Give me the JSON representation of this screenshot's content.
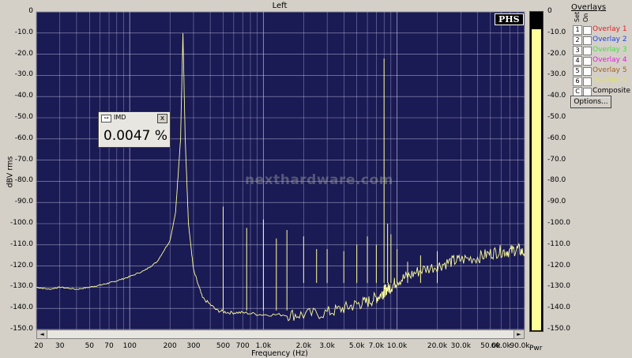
{
  "window": {
    "title": "Left"
  },
  "plot_bg": "#1a1a55",
  "trace_color": "#ffff99",
  "chart_data": {
    "type": "line",
    "xlabel": "Frequency (Hz)",
    "ylabel": "dBV rms",
    "xscale": "log",
    "xlim": [
      20,
      90000
    ],
    "ylim": [
      -150,
      0
    ],
    "y_ticks": [
      "0",
      "-10.0",
      "-20.0",
      "-30.0",
      "-40.0",
      "-50.0",
      "-60.0",
      "-70.0",
      "-80.0",
      "-90.0",
      "-100.0",
      "-110.0",
      "-120.0",
      "-130.0",
      "-140.0",
      "-150.0"
    ],
    "x_ticks": [
      {
        "v": 20,
        "label": "20"
      },
      {
        "v": 30,
        "label": "30"
      },
      {
        "v": 50,
        "label": "50"
      },
      {
        "v": 70,
        "label": "70"
      },
      {
        "v": 100,
        "label": "100"
      },
      {
        "v": 200,
        "label": "200"
      },
      {
        "v": 300,
        "label": "300"
      },
      {
        "v": 500,
        "label": "500"
      },
      {
        "v": 700,
        "label": "700"
      },
      {
        "v": 1000,
        "label": "1.0k"
      },
      {
        "v": 2000,
        "label": "2.0k"
      },
      {
        "v": 3000,
        "label": "3.0k"
      },
      {
        "v": 5000,
        "label": "5.0k"
      },
      {
        "v": 7000,
        "label": "7.0k"
      },
      {
        "v": 10000,
        "label": "10.0k"
      },
      {
        "v": 20000,
        "label": "20.0k"
      },
      {
        "v": 30000,
        "label": "30.0k"
      },
      {
        "v": 50000,
        "label": "50.0k"
      },
      {
        "v": 60000,
        "label": "60.0k"
      },
      {
        "v": 90000,
        "label": "90.0k"
      }
    ],
    "series": [
      {
        "x": [
          20,
          25,
          30,
          40,
          50,
          60,
          70,
          80,
          100,
          130,
          160,
          200,
          220,
          240,
          250,
          260,
          275,
          300,
          350,
          450,
          550,
          700,
          1000,
          1500,
          2000,
          3000,
          4000,
          5000,
          6000,
          7000,
          7800,
          8000,
          8300,
          9000,
          10000,
          12000,
          15000,
          20000,
          25000,
          30000,
          40000,
          50000,
          60000,
          70000,
          80000,
          90000
        ],
        "y": [
          -130,
          -131,
          -130,
          -131,
          -130,
          -129,
          -128,
          -127,
          -125,
          -122,
          -118,
          -108,
          -95,
          -60,
          -10,
          -60,
          -100,
          -122,
          -135,
          -141,
          -142,
          -142,
          -143,
          -143,
          -143,
          -142,
          -140,
          -138,
          -137,
          -135,
          -133,
          -132,
          -131,
          -130,
          -127,
          -125,
          -122,
          -120,
          -118,
          -117,
          -116,
          -114,
          -113,
          -113,
          -112,
          -114
        ]
      }
    ],
    "spikes": [
      {
        "x": 500,
        "y": -92
      },
      {
        "x": 750,
        "y": -102
      },
      {
        "x": 1000,
        "y": -98
      },
      {
        "x": 1250,
        "y": -107
      },
      {
        "x": 1500,
        "y": -103
      },
      {
        "x": 2000,
        "y": -106
      },
      {
        "x": 2500,
        "y": -112
      },
      {
        "x": 3000,
        "y": -112
      },
      {
        "x": 4000,
        "y": -113
      },
      {
        "x": 5000,
        "y": -110
      },
      {
        "x": 6000,
        "y": -106
      },
      {
        "x": 7000,
        "y": -110
      },
      {
        "x": 8000,
        "y": -22
      },
      {
        "x": 8500,
        "y": -100
      },
      {
        "x": 9000,
        "y": -105
      },
      {
        "x": 10000,
        "y": -112
      },
      {
        "x": 12000,
        "y": -118
      },
      {
        "x": 15000,
        "y": -115
      },
      {
        "x": 20000,
        "y": -113
      }
    ]
  },
  "imd_window": {
    "title": "IMD",
    "value": "0.0047 %",
    "close": "x"
  },
  "phs_logo": "PHS",
  "watermark": "nexthardware.com",
  "meter": {
    "level_db": -8,
    "labels": [
      "0",
      "-10.0",
      "-20.0",
      "-30.0",
      "-40.0",
      "-50.0",
      "-60.0",
      "-70.0",
      "-80.0",
      "-90.0",
      "-100.0",
      "-110.0",
      "-120.0",
      "-130.0",
      "-140.0",
      "-150.0"
    ],
    "pwr_label": "Pwr"
  },
  "overlays": {
    "title": "Overlays",
    "set_label": "Set",
    "on_label": "On",
    "items": [
      {
        "num": "1",
        "name": "Overlay 1",
        "color": "#e02020"
      },
      {
        "num": "2",
        "name": "Overlay 2",
        "color": "#2040e0"
      },
      {
        "num": "3",
        "name": "Overlay 3",
        "color": "#40e040"
      },
      {
        "num": "4",
        "name": "Overlay 4",
        "color": "#e020e0"
      },
      {
        "num": "5",
        "name": "Overlay 5",
        "color": "#a06020"
      },
      {
        "num": "6",
        "name": "Overlay 6",
        "color": "#e0e060"
      },
      {
        "num": "C",
        "name": "Composite",
        "color": "#000000"
      }
    ],
    "options_label": "Options..."
  },
  "scroll": {
    "left": "◄",
    "right": "►"
  }
}
